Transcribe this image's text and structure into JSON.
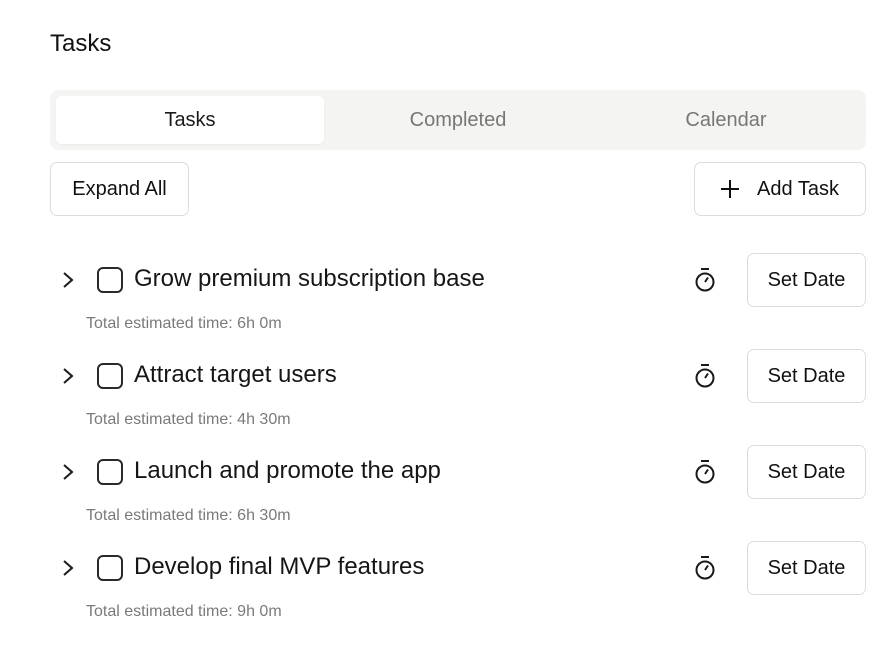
{
  "page": {
    "title": "Tasks"
  },
  "tabs": [
    {
      "label": "Tasks",
      "active": true
    },
    {
      "label": "Completed",
      "active": false
    },
    {
      "label": "Calendar",
      "active": false
    }
  ],
  "toolbar": {
    "expand_label": "Expand All",
    "add_label": "Add Task"
  },
  "tasks": [
    {
      "title": "Grow premium subscription base",
      "estimate": "Total estimated time: 6h 0m",
      "date_label": "Set Date",
      "checked": false
    },
    {
      "title": "Attract target users",
      "estimate": "Total estimated time: 4h 30m",
      "date_label": "Set Date",
      "checked": false
    },
    {
      "title": "Launch and promote the app",
      "estimate": "Total estimated time: 6h 30m",
      "date_label": "Set Date",
      "checked": false
    },
    {
      "title": "Develop final MVP features",
      "estimate": "Total estimated time: 9h 0m",
      "date_label": "Set Date",
      "checked": false
    }
  ],
  "icons": {
    "expand": "chevron-right-icon",
    "timer": "stopwatch-icon",
    "add": "plus-icon"
  },
  "colors": {
    "tabbar_bg": "#f4f4f3",
    "border": "#dcdcdc",
    "muted_text": "#7a7a7a"
  }
}
